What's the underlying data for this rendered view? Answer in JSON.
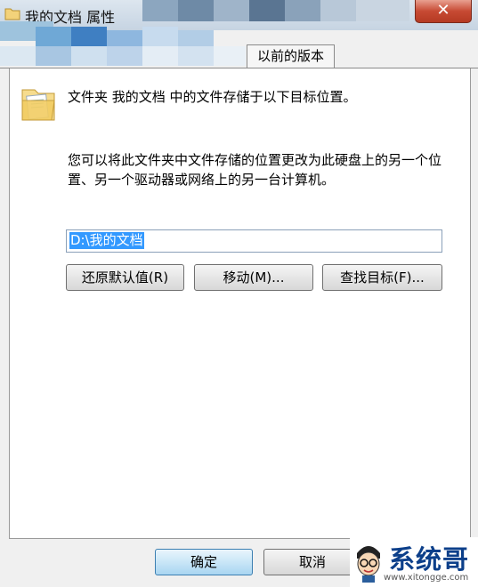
{
  "window": {
    "title": "我的文档 属性",
    "close_label": "✕"
  },
  "tabs": {
    "visible": [
      "以前的版本"
    ]
  },
  "location": {
    "description": "文件夹 我的文档 中的文件存储于以下目标位置。",
    "instructions": "您可以将此文件夹中文件存储的位置更改为此硬盘上的另一个位置、另一个驱动器或网络上的另一台计算机。",
    "path_value": "D:\\我的文档",
    "restore_label": "还原默认值(R)",
    "move_label": "移动(M)...",
    "find_label": "查找目标(F)..."
  },
  "footer": {
    "ok_label": "确定",
    "cancel_label": "取消"
  },
  "watermark": {
    "brand": "系统哥",
    "url": "www.xitongge.com"
  },
  "colors": {
    "selection": "#3399ff",
    "panel_bg": "#ffffff",
    "window_bg": "#f0f0f0",
    "brand": "#0c3f8a"
  }
}
